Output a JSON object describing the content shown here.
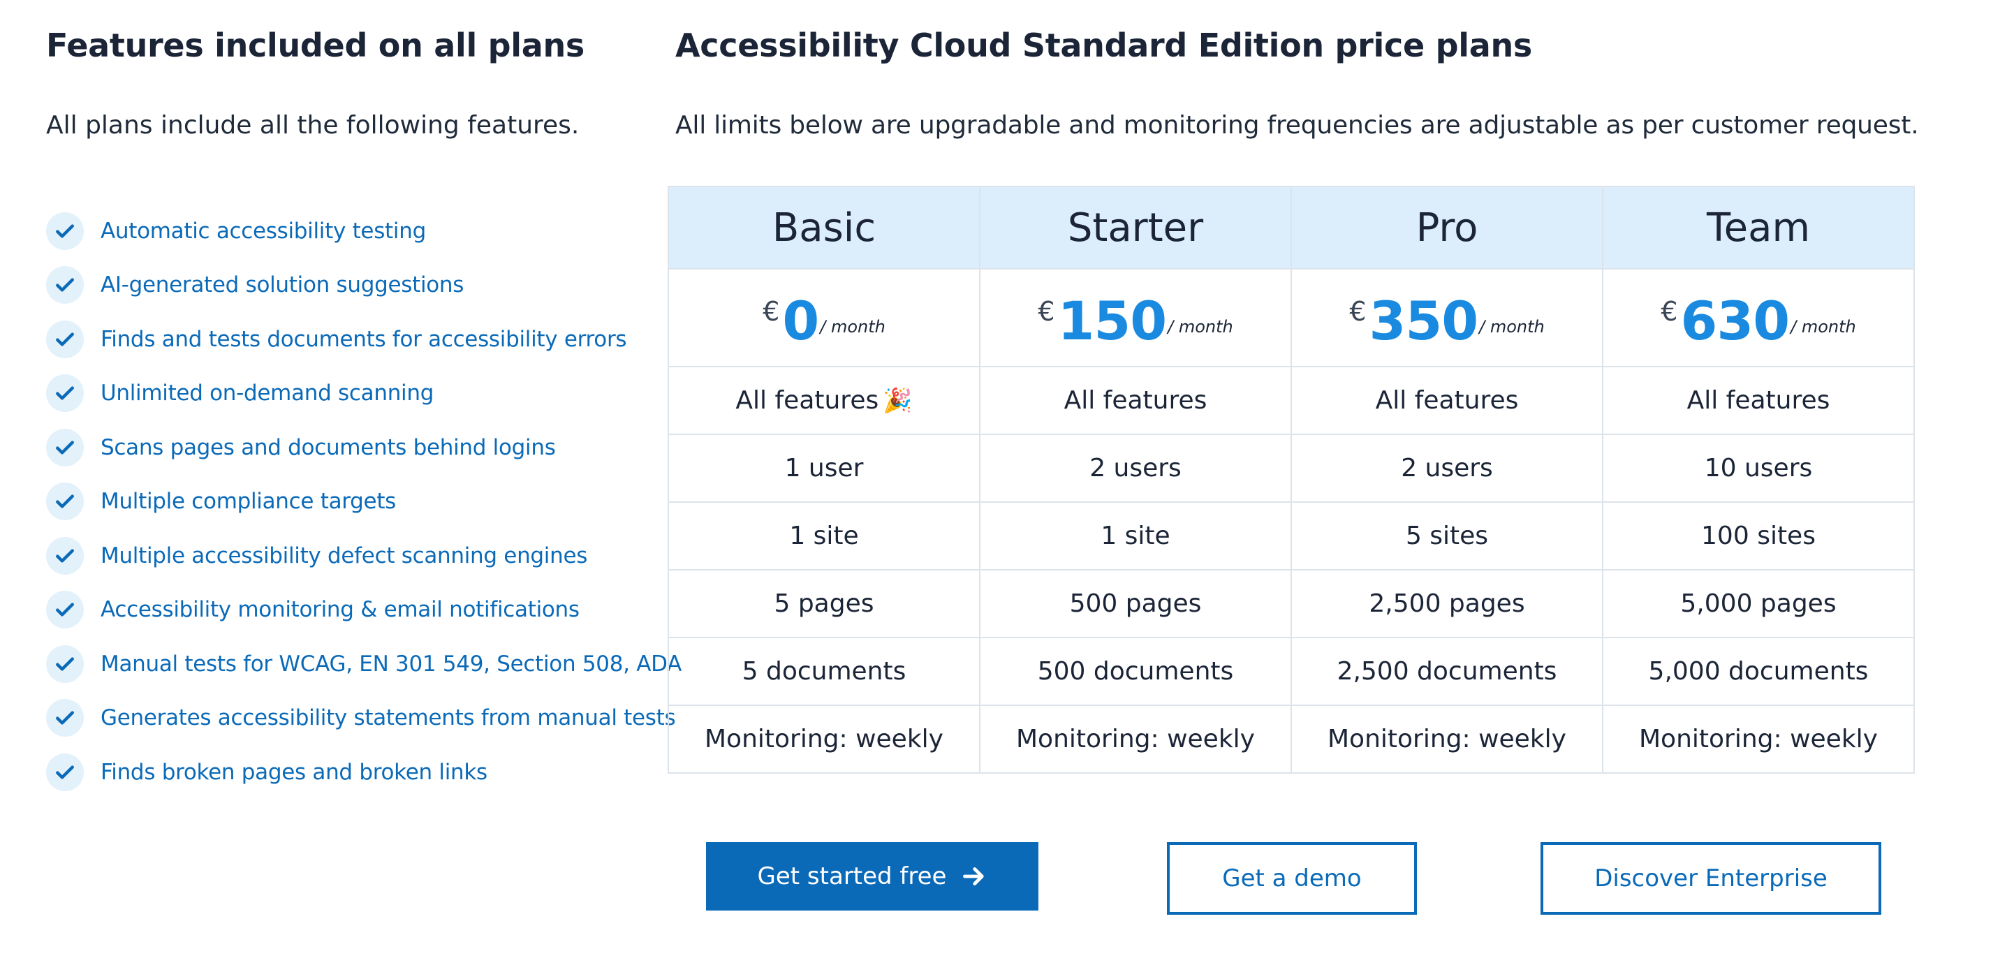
{
  "features_section": {
    "title": "Features included on all plans",
    "intro": "All plans include all the following features.",
    "items": [
      "Automatic accessibility testing",
      "AI-generated solution suggestions",
      "Finds and tests documents for accessibility errors",
      "Unlimited on-demand scanning",
      "Scans pages and documents behind logins",
      "Multiple compliance targets",
      "Multiple accessibility defect scanning engines",
      "Accessibility monitoring & email notifications",
      "Manual tests for WCAG, EN 301 549, Section 508, ADA",
      "Generates accessibility statements from manual tests",
      "Finds broken pages and broken links"
    ],
    "icon": "check-icon"
  },
  "plans_section": {
    "title": "Accessibility Cloud Standard Edition price plans",
    "intro": "All limits below are upgradable and monitoring frequencies are adjustable as per customer request.",
    "currency": "€",
    "per": "/ month",
    "plans": [
      {
        "name": "Basic",
        "price": "0",
        "features": "All features",
        "features_emoji": "🎉",
        "users": "1 user",
        "sites": "1 site",
        "pages": "5 pages",
        "documents": "5 documents",
        "monitoring": "Monitoring: weekly"
      },
      {
        "name": "Starter",
        "price": "150",
        "features": "All features",
        "users": "2 users",
        "sites": "1 site",
        "pages": "500 pages",
        "documents": "500 documents",
        "monitoring": "Monitoring: weekly"
      },
      {
        "name": "Pro",
        "price": "350",
        "features": "All features",
        "users": "2 users",
        "sites": "5 sites",
        "pages": "2,500 pages",
        "documents": "2,500 documents",
        "monitoring": "Monitoring: weekly"
      },
      {
        "name": "Team",
        "price": "630",
        "features": "All features",
        "users": "10 users",
        "sites": "100 sites",
        "pages": "5,000 pages",
        "documents": "5,000 documents",
        "monitoring": "Monitoring: weekly"
      }
    ]
  },
  "actions": {
    "get_started": "Get started free",
    "get_started_icon": "arrow-right-icon",
    "demo": "Get a demo",
    "enterprise": "Discover Enterprise"
  },
  "colors": {
    "brand_blue": "#0b6ab8",
    "price_blue": "#1a8ae0",
    "header_bg": "#dcedfb",
    "check_bg": "#e3f1fb"
  }
}
